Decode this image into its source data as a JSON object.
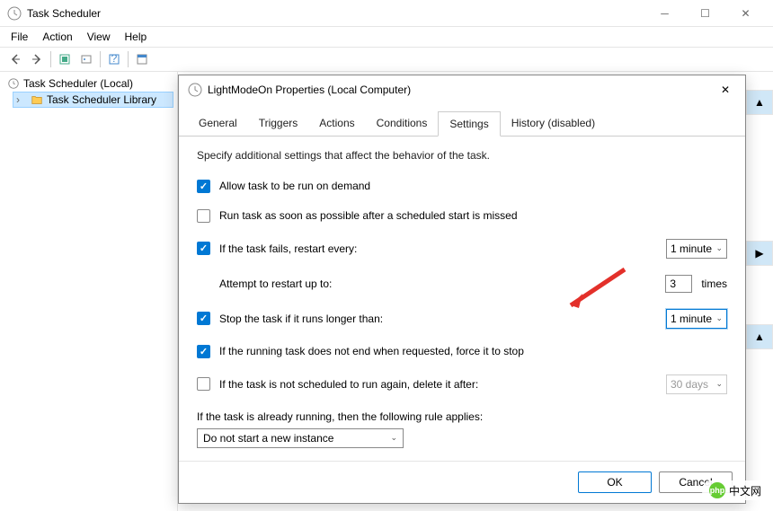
{
  "window": {
    "title": "Task Scheduler"
  },
  "menubar": [
    "File",
    "Action",
    "View",
    "Help"
  ],
  "sidebar": {
    "root": "Task Scheduler (Local)",
    "child": "Task Scheduler Library"
  },
  "dialog": {
    "title": "LightModeOn Properties (Local Computer)",
    "tabs": [
      "General",
      "Triggers",
      "Actions",
      "Conditions",
      "Settings",
      "History (disabled)"
    ],
    "active_tab": 4,
    "description": "Specify additional settings that affect the behavior of the task.",
    "options": {
      "allow_demand": {
        "checked": true,
        "label": "Allow task to be run on demand"
      },
      "run_asap": {
        "checked": false,
        "label": "Run task as soon as possible after a scheduled start is missed"
      },
      "if_fails": {
        "checked": true,
        "label": "If the task fails, restart every:",
        "value": "1 minute"
      },
      "attempt": {
        "label": "Attempt to restart up to:",
        "value": "3",
        "suffix": "times"
      },
      "stop_longer": {
        "checked": true,
        "label": "Stop the task if it runs longer than:",
        "value": "1 minute"
      },
      "force_stop": {
        "checked": true,
        "label": "If the running task does not end when requested, force it to stop"
      },
      "delete_after": {
        "checked": false,
        "label": "If the task is not scheduled to run again, delete it after:",
        "value": "30 days"
      },
      "already_running": {
        "label": "If the task is already running, then the following rule applies:",
        "value": "Do not start a new instance"
      }
    },
    "buttons": {
      "ok": "OK",
      "cancel": "Cancel"
    }
  },
  "badge": {
    "text": "中文网",
    "short": "php"
  }
}
